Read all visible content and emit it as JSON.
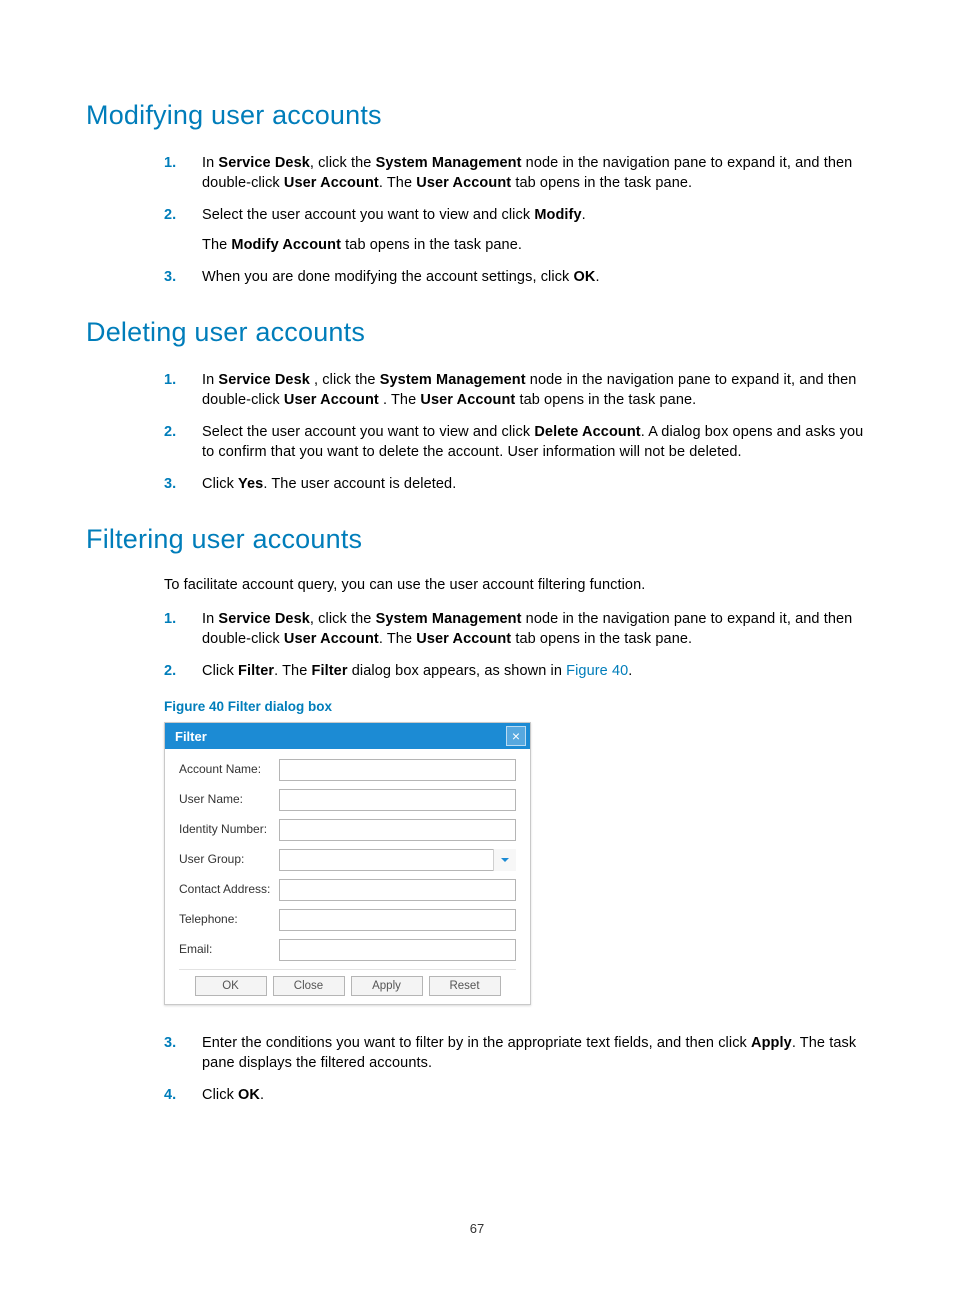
{
  "pageNumber": "67",
  "modifying": {
    "heading": "Modifying user accounts",
    "s1_pre": "In ",
    "s1_b1": "Service Desk",
    "s1_mid1": ", click the ",
    "s1_b2": "System Management",
    "s1_mid2": " node in the navigation pane to expand it, and then double-click ",
    "s1_b3": "User Account",
    "s1_mid3": ". The ",
    "s1_b4": "User Account",
    "s1_post": " tab opens in the task pane.",
    "s2_pre": "Select the user account you want to view and click ",
    "s2_b1": "Modify",
    "s2_post": ".",
    "s2_p2_pre": "The ",
    "s2_p2_b": "Modify Account",
    "s2_p2_post": " tab opens in the task pane.",
    "s3_pre": "When you are done modifying the account settings, click ",
    "s3_b1": "OK",
    "s3_post": "."
  },
  "deleting": {
    "heading": "Deleting user accounts",
    "s1_pre": "In ",
    "s1_b1": "Service Desk ",
    "s1_mid1": ", click the ",
    "s1_b2": "System Management ",
    "s1_mid2": " node in the navigation pane to expand it, and then double-click ",
    "s1_b3": "User Account ",
    "s1_mid3": ". The ",
    "s1_b4": "User Account",
    "s1_post": " tab opens in the task pane.",
    "s2_pre": "Select the user account you want to view and click ",
    "s2_b1": "Delete Account",
    "s2_post": ". A dialog box opens and asks you to confirm that you want to delete the account. User information will not be deleted.",
    "s3_pre": "Click ",
    "s3_b1": "Yes",
    "s3_post": ". The user account is deleted."
  },
  "filtering": {
    "heading": "Filtering user accounts",
    "intro": "To facilitate account query, you can use the user account filtering function.",
    "s1_pre": "In ",
    "s1_b1": "Service Desk",
    "s1_mid1": ", click the ",
    "s1_b2": "System Management",
    "s1_mid2": " node in the navigation pane to expand it, and then double-click ",
    "s1_b3": "User Account",
    "s1_mid3": ". The ",
    "s1_b4": "User Account",
    "s1_post": " tab opens in the task pane.",
    "s2_pre": "Click ",
    "s2_b1": "Filter",
    "s2_mid": ". The ",
    "s2_b2": "Filter",
    "s2_mid2": " dialog box appears, as shown in ",
    "s2_link": "Figure 40",
    "s2_post": ".",
    "figCaption": "Figure 40 Filter dialog box",
    "dialog": {
      "title": "Filter",
      "fields": {
        "accountName": "Account Name:",
        "userName": "User Name:",
        "identity": "Identity Number:",
        "userGroup": "User Group:",
        "contact": "Contact Address:",
        "telephone": "Telephone:",
        "email": "Email:"
      },
      "buttons": {
        "ok": "OK",
        "close": "Close",
        "apply": "Apply",
        "reset": "Reset"
      }
    },
    "s3_pre": "Enter the conditions you want to filter by in the appropriate text fields, and then click ",
    "s3_b1": "Apply",
    "s3_post": ". The task pane displays the filtered accounts.",
    "s4_pre": "Click ",
    "s4_b1": "OK",
    "s4_post": "."
  }
}
